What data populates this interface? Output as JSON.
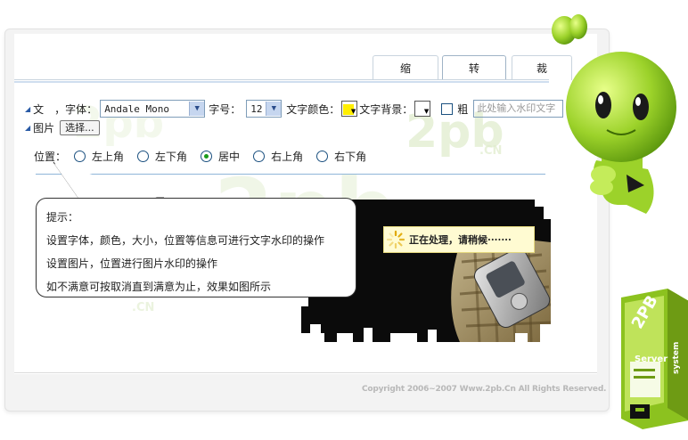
{
  "tabs": [
    {
      "label": "缩"
    },
    {
      "label": "转"
    },
    {
      "label": "裁"
    }
  ],
  "text_row": {
    "label_text": "文",
    "label_font": "，字体：",
    "font_value": "Andale Mono",
    "label_size": "字号：",
    "size_value": "12",
    "label_color": "文字颜色：",
    "color_value": "#ffee00",
    "label_bg": "文字背景：",
    "bg_value": "#ffffff",
    "bold_label": "粗",
    "watermark_placeholder": "此处输入水印文字"
  },
  "image_row": {
    "label": "图片",
    "choose_button": "选择..."
  },
  "position_row": {
    "label": "位置：",
    "options": [
      "左上角",
      "左下角",
      "居中",
      "右上角",
      "右下角"
    ],
    "selected": "居中"
  },
  "tip": {
    "title": "提示：",
    "lines": [
      "设置字体，颜色，大小，位置等信息可进行文字水印的操作",
      "设置图片，位置进行图片水印的操作",
      "如不满意可按取消直到满意为止，效果如图所示"
    ]
  },
  "processing_text": "正在处理，请稍候·······",
  "copyright": "Copyright 2006~2007 Www.2pb.Cn All Rights Reserved.",
  "watermark": {
    "big": "2pb",
    "small": ".CN"
  },
  "server_box": {
    "brand": "2PB",
    "label": "Server",
    "side": "system"
  },
  "colors": {
    "accent_green": "#9cd22a",
    "tab_blue": "#3f7cc0",
    "highlight_yellow": "#fffbd2"
  }
}
